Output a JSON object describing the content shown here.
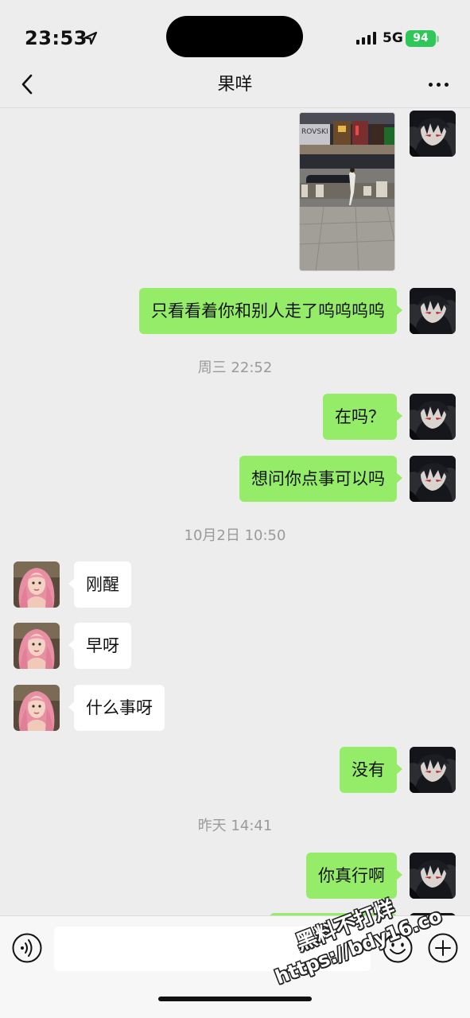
{
  "status_bar": {
    "time": "23:53",
    "network": "5G",
    "battery": "94"
  },
  "header": {
    "title": "果咩"
  },
  "messages": [
    {
      "sender": "me",
      "type": "image"
    },
    {
      "sender": "me",
      "type": "text",
      "text": "只看看着你和别人走了呜呜呜呜"
    },
    {
      "type": "timestamp",
      "text": "周三 22:52"
    },
    {
      "sender": "me",
      "type": "text",
      "text": "在吗？"
    },
    {
      "sender": "me",
      "type": "text",
      "text": "想问你点事可以吗"
    },
    {
      "type": "timestamp",
      "text": "10月2日 10:50"
    },
    {
      "sender": "other",
      "type": "text",
      "text": "刚醒"
    },
    {
      "sender": "other",
      "type": "text",
      "text": "早呀"
    },
    {
      "sender": "other",
      "type": "text",
      "text": "什么事呀"
    },
    {
      "sender": "me",
      "type": "text",
      "text": "没有"
    },
    {
      "type": "timestamp",
      "text": "昨天 14:41"
    },
    {
      "sender": "me",
      "type": "text",
      "text": "你真行啊"
    }
  ],
  "photo_sign_text": "ROVSKI",
  "input_bar": {
    "placeholder": ""
  },
  "watermark": {
    "line1": "黑料不打烊",
    "line2": "https://bdy16.co"
  },
  "colors": {
    "my_bubble": "#95ec69",
    "other_bubble": "#ffffff",
    "background": "#ededed",
    "battery": "#30c75a"
  },
  "icons": [
    "location-arrow-icon",
    "signal-icon",
    "battery-icon",
    "back-chevron-icon",
    "more-dots-icon",
    "voice-icon",
    "emoji-icon",
    "plus-icon"
  ]
}
